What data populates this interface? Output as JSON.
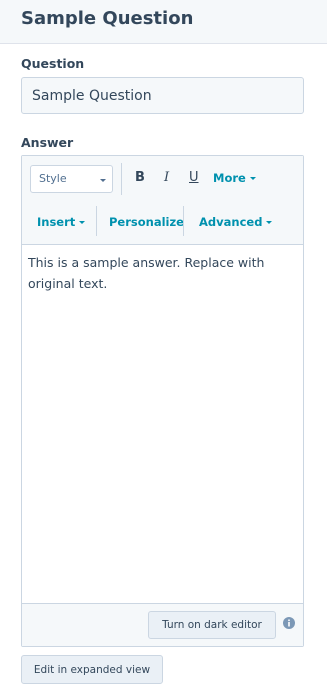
{
  "header": {
    "title": "Sample Question"
  },
  "question": {
    "label": "Question",
    "value": "Sample Question"
  },
  "answer": {
    "label": "Answer",
    "toolbar": {
      "style_select": "Style",
      "bold": "B",
      "italic": "I",
      "underline": "U",
      "more": "More",
      "insert": "Insert",
      "personalize": "Personalize",
      "advanced": "Advanced"
    },
    "content": "This is a sample answer. Replace with original text.",
    "dark_editor_button": "Turn on dark editor"
  },
  "expanded_view_button": "Edit in expanded view",
  "colors": {
    "accent": "#0091ae",
    "text": "#33475b",
    "border": "#cbd6e2",
    "background": "#f5f8fa"
  },
  "icons": {
    "info": "info-icon",
    "dropdown": "caret-down-icon"
  }
}
